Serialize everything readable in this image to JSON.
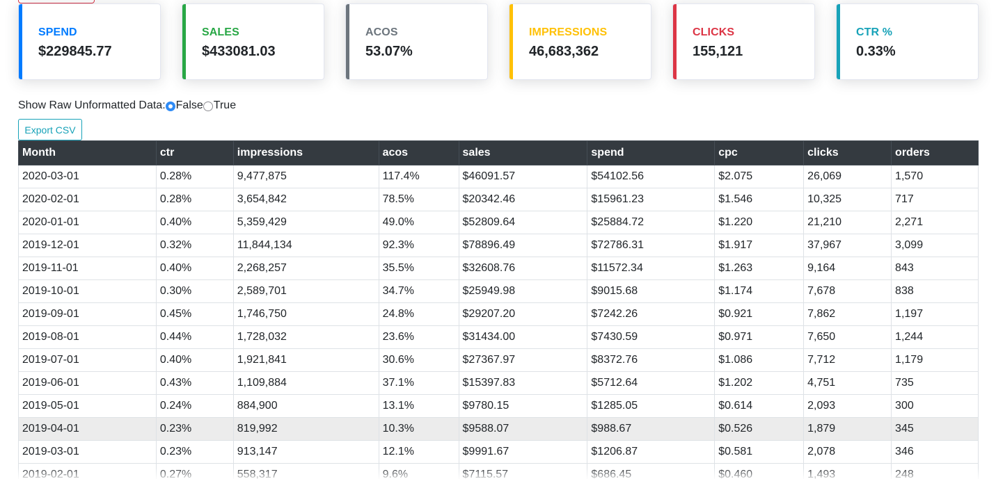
{
  "colors": {
    "spend": "#007bff",
    "sales": "#28a745",
    "acos": "#6c757d",
    "impressions": "#ffc107",
    "clicks": "#dc3545",
    "ctr": "#17a2b8",
    "header_bg": "#343a40"
  },
  "cards": [
    {
      "label": "SPEND",
      "value": "$229845.77"
    },
    {
      "label": "SALES",
      "value": "$433081.03"
    },
    {
      "label": "ACOS",
      "value": "53.07%"
    },
    {
      "label": "IMPRESSIONS",
      "value": "46,683,362"
    },
    {
      "label": "CLICKS",
      "value": "155,121"
    },
    {
      "label": "CTR %",
      "value": "0.33%"
    }
  ],
  "raw_toggle": {
    "label": "Show Raw Unformatted Data:",
    "options": [
      "False",
      "True"
    ],
    "selected": "False"
  },
  "export_label": "Export CSV",
  "table": {
    "columns": [
      "Month",
      "ctr",
      "impressions",
      "acos",
      "sales",
      "spend",
      "cpc",
      "clicks",
      "orders"
    ],
    "rows": [
      [
        "2020-03-01",
        "0.28%",
        "9,477,875",
        "117.4%",
        "$46091.57",
        "$54102.56",
        "$2.075",
        "26,069",
        "1,570"
      ],
      [
        "2020-02-01",
        "0.28%",
        "3,654,842",
        "78.5%",
        "$20342.46",
        "$15961.23",
        "$1.546",
        "10,325",
        "717"
      ],
      [
        "2020-01-01",
        "0.40%",
        "5,359,429",
        "49.0%",
        "$52809.64",
        "$25884.72",
        "$1.220",
        "21,210",
        "2,271"
      ],
      [
        "2019-12-01",
        "0.32%",
        "11,844,134",
        "92.3%",
        "$78896.49",
        "$72786.31",
        "$1.917",
        "37,967",
        "3,099"
      ],
      [
        "2019-11-01",
        "0.40%",
        "2,268,257",
        "35.5%",
        "$32608.76",
        "$11572.34",
        "$1.263",
        "9,164",
        "843"
      ],
      [
        "2019-10-01",
        "0.30%",
        "2,589,701",
        "34.7%",
        "$25949.98",
        "$9015.68",
        "$1.174",
        "7,678",
        "838"
      ],
      [
        "2019-09-01",
        "0.45%",
        "1,746,750",
        "24.8%",
        "$29207.20",
        "$7242.26",
        "$0.921",
        "7,862",
        "1,197"
      ],
      [
        "2019-08-01",
        "0.44%",
        "1,728,032",
        "23.6%",
        "$31434.00",
        "$7430.59",
        "$0.971",
        "7,650",
        "1,244"
      ],
      [
        "2019-07-01",
        "0.40%",
        "1,921,841",
        "30.6%",
        "$27367.97",
        "$8372.76",
        "$1.086",
        "7,712",
        "1,179"
      ],
      [
        "2019-06-01",
        "0.43%",
        "1,109,884",
        "37.1%",
        "$15397.83",
        "$5712.64",
        "$1.202",
        "4,751",
        "735"
      ],
      [
        "2019-05-01",
        "0.24%",
        "884,900",
        "13.1%",
        "$9780.15",
        "$1285.05",
        "$0.614",
        "2,093",
        "300"
      ],
      [
        "2019-04-01",
        "0.23%",
        "819,992",
        "10.3%",
        "$9588.07",
        "$988.67",
        "$0.526",
        "1,879",
        "345"
      ],
      [
        "2019-03-01",
        "0.23%",
        "913,147",
        "12.1%",
        "$9991.67",
        "$1206.87",
        "$0.581",
        "2,078",
        "346"
      ],
      [
        "2019-02-01",
        "0.27%",
        "558,317",
        "9.6%",
        "$7115.57",
        "$686.45",
        "$0.460",
        "1,493",
        "248"
      ]
    ],
    "hover_row": 11
  }
}
